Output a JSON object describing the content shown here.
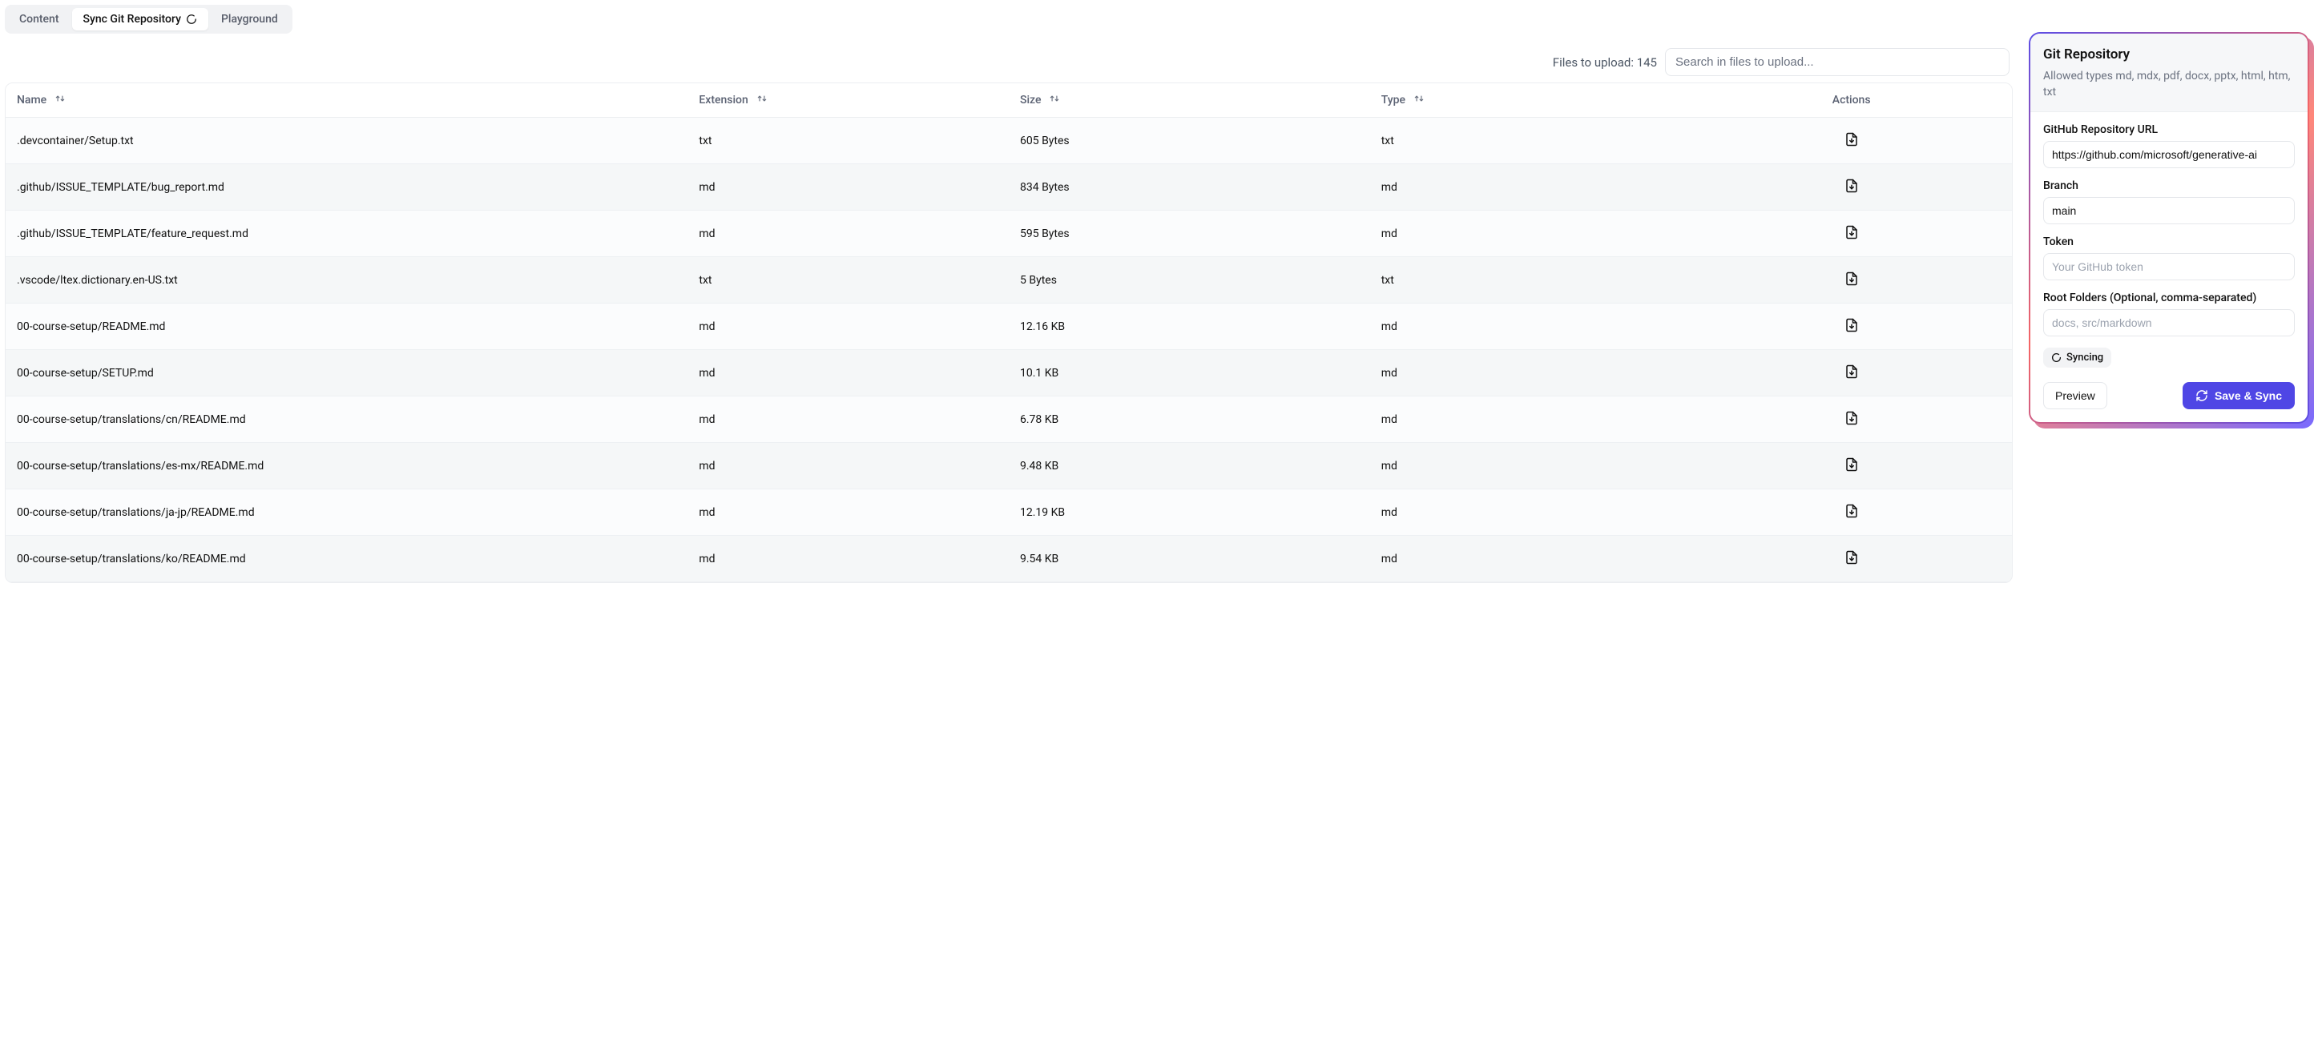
{
  "tabs": {
    "content": "Content",
    "sync": "Sync Git Repository",
    "playground": "Playground"
  },
  "search": {
    "count_label": "Files to upload: 145",
    "placeholder": "Search in files to upload..."
  },
  "table": {
    "headers": {
      "name": "Name",
      "extension": "Extension",
      "size": "Size",
      "type": "Type",
      "actions": "Actions"
    },
    "rows": [
      {
        "name": ".devcontainer/Setup.txt",
        "ext": "txt",
        "size": "605 Bytes",
        "type": "txt"
      },
      {
        "name": ".github/ISSUE_TEMPLATE/bug_report.md",
        "ext": "md",
        "size": "834 Bytes",
        "type": "md"
      },
      {
        "name": ".github/ISSUE_TEMPLATE/feature_request.md",
        "ext": "md",
        "size": "595 Bytes",
        "type": "md"
      },
      {
        "name": ".vscode/ltex.dictionary.en-US.txt",
        "ext": "txt",
        "size": "5 Bytes",
        "type": "txt"
      },
      {
        "name": "00-course-setup/README.md",
        "ext": "md",
        "size": "12.16 KB",
        "type": "md"
      },
      {
        "name": "00-course-setup/SETUP.md",
        "ext": "md",
        "size": "10.1 KB",
        "type": "md"
      },
      {
        "name": "00-course-setup/translations/cn/README.md",
        "ext": "md",
        "size": "6.78 KB",
        "type": "md"
      },
      {
        "name": "00-course-setup/translations/es-mx/README.md",
        "ext": "md",
        "size": "9.48 KB",
        "type": "md"
      },
      {
        "name": "00-course-setup/translations/ja-jp/README.md",
        "ext": "md",
        "size": "12.19 KB",
        "type": "md"
      },
      {
        "name": "00-course-setup/translations/ko/README.md",
        "ext": "md",
        "size": "9.54 KB",
        "type": "md"
      }
    ]
  },
  "panel": {
    "title": "Git Repository",
    "subtitle": "Allowed types md, mdx, pdf, docx, pptx, html, htm, txt",
    "url_label": "GitHub Repository URL",
    "url_value": "https://github.com/microsoft/generative-ai",
    "branch_label": "Branch",
    "branch_value": "main",
    "token_label": "Token",
    "token_placeholder": "Your GitHub token",
    "root_label": "Root Folders (Optional, comma-separated)",
    "root_placeholder": "docs, src/markdown",
    "syncing_badge": "Syncing",
    "preview_btn": "Preview",
    "save_btn": "Save & Sync"
  }
}
